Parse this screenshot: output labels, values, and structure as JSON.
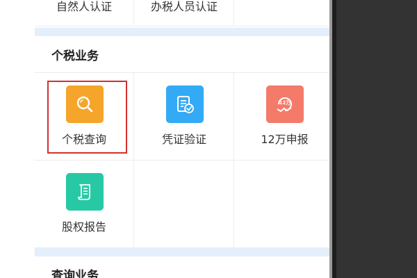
{
  "top_row": {
    "items": [
      {
        "label": "自然人认证"
      },
      {
        "label": "办税人员认证"
      },
      {
        "label": ""
      }
    ]
  },
  "tax_section": {
    "title": "个税业务",
    "items": [
      {
        "label": "个税查询",
        "icon": "search-icon",
        "color": "#f5a52a",
        "highlighted": true
      },
      {
        "label": "凭证验证",
        "icon": "certificate-check-icon",
        "color": "#33aaf5"
      },
      {
        "label": "12万申报",
        "icon": "12w-declaration-icon",
        "color": "#f47a6a"
      },
      {
        "label": "股权报告",
        "icon": "scroll-document-icon",
        "color": "#27c9a5"
      }
    ]
  },
  "query_section": {
    "title": "查询业务"
  },
  "colors": {
    "band": "#e3effb",
    "highlight_border": "#d32f2f",
    "outer_background": "#333333"
  }
}
